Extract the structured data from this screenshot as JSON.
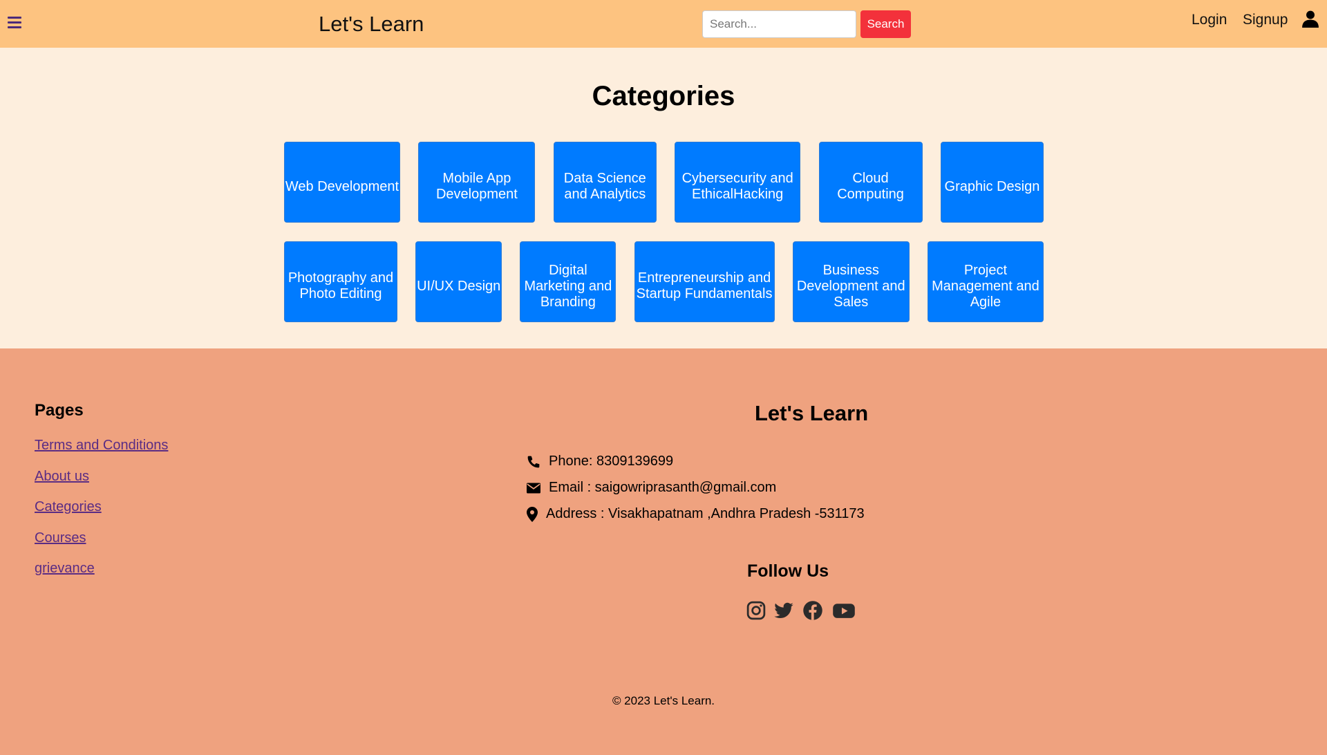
{
  "header": {
    "brand": "Let's Learn",
    "search_placeholder": "Search...",
    "search_button": "Search",
    "login": "Login",
    "signup": "Signup"
  },
  "categories": {
    "title": "Categories",
    "row1": [
      "Web Development",
      "Mobile App Development",
      "Data Science and Analytics",
      "Cybersecurity and EthicalHacking",
      "Cloud Computing",
      "Graphic Design"
    ],
    "row2": [
      "Photography and Photo Editing",
      "UI/UX Design",
      "Digital Marketing and Branding",
      "Entrepreneurship and Startup Fundamentals",
      "Business Development and Sales",
      "Project Management and Agile"
    ]
  },
  "footer": {
    "pages_title": "Pages",
    "pages": [
      "Terms and Conditions",
      "About us",
      "Categories",
      "Courses",
      "grievance"
    ],
    "brand": "Let's Learn",
    "phone": "Phone: 8309139699",
    "email": "Email : saigowriprasanth@gmail.com",
    "address": "Address : Visakhapatnam ,Andhra Pradesh -531173",
    "follow_title": "Follow Us",
    "social_icons": [
      "instagram-icon",
      "twitter-icon",
      "facebook-icon",
      "youtube-icon"
    ],
    "copyright": "© 2023 Let's Learn."
  },
  "colors": {
    "header_bg": "#fdc380",
    "page_bg": "#fdeedd",
    "footer_bg": "#efa27f",
    "category_button": "#007bff",
    "search_button": "#f3313b",
    "link": "#5a2c84"
  }
}
